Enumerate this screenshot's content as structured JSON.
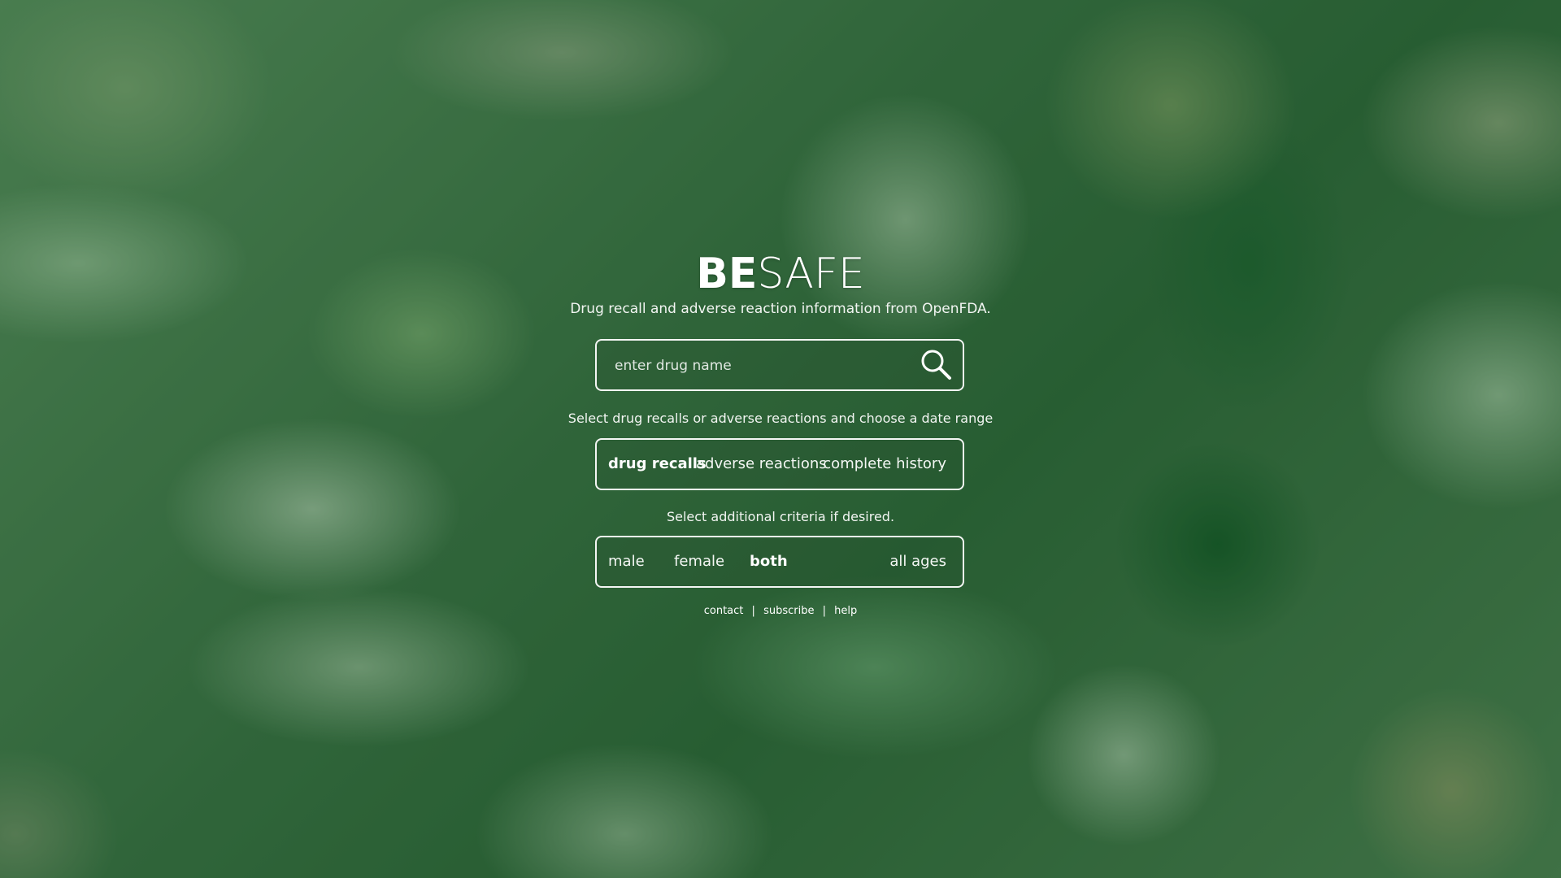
{
  "brand": {
    "bold": "BE",
    "light": "SAFE"
  },
  "tagline": "Drug recall and adverse reaction information from OpenFDA.",
  "search": {
    "placeholder": "enter drug name",
    "value": "",
    "icon": "search-icon"
  },
  "hints": {
    "type_range": "Select drug recalls or adverse reactions and choose a date range",
    "criteria": "Select additional criteria if desired."
  },
  "type_options": {
    "drug_recalls": "drug recalls",
    "adverse_reactions": "adverse reactions",
    "date_range": "complete history",
    "selected": "drug recalls"
  },
  "criteria_options": {
    "male": "male",
    "female": "female",
    "both": "both",
    "age": "all ages",
    "selected": "both"
  },
  "footer": {
    "contact": "contact",
    "subscribe": "subscribe",
    "help": "help",
    "separator": "|"
  },
  "colors": {
    "overlay": "#145a1e",
    "text": "#ffffff"
  }
}
